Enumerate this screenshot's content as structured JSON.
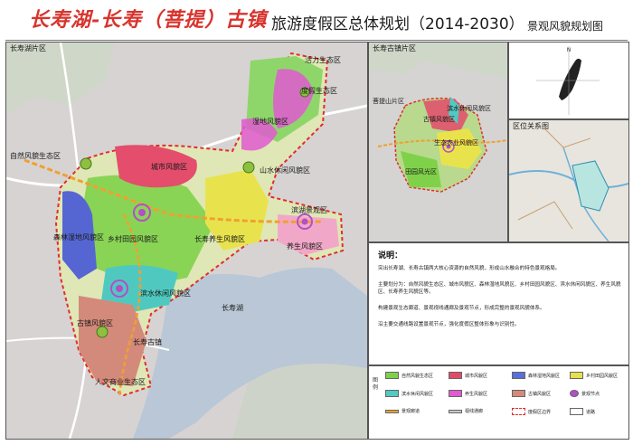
{
  "header": {
    "callig_title": "长寿湖-长寿（菩提）古镇",
    "main_title": "旅游度假区总体规划（2014-2030）",
    "sheet_title": "景观风貌规划图"
  },
  "main_map": {
    "area_label": "长寿湖片区",
    "zone_labels": {
      "z1": "自然风貌生态区",
      "z2": "城市风貌区",
      "z3": "森林湿地风貌区",
      "z4": "乡村田园风貌区",
      "z5": "滨水休闲风貌区",
      "z6": "养生风貌区",
      "z7": "长寿养生风貌区",
      "z8": "活力生态区",
      "z9": "山水休闲风貌区",
      "z10": "古镇风貌区",
      "z11": "人文商业生态区",
      "z12": "湿地风貌区",
      "z13": "度假生态区",
      "z14": "滨湖景观区"
    },
    "place_labels": {
      "lake": "长寿湖",
      "town": "长寿古镇"
    }
  },
  "inset_map": {
    "area_label": "长寿古镇片区",
    "zone_labels": {
      "a": "古镇风貌区",
      "b": "生态农业风貌区",
      "c": "滨水休闲风貌区",
      "d": "田园风光区"
    },
    "side_label": "菩提山片区"
  },
  "region_map": {
    "title": "区位关系图"
  },
  "notes": {
    "title": "说明：",
    "lines": [
      "突出长寿湖、长寿古镇两大核心资源的自然风貌，形成山水融合的特色景观格局。",
      "主要划分为：自然风貌生态区、城市风貌区、森林湿地风貌区、乡村田园风貌区、滨水休闲风貌区、养生风貌区、长寿养生风貌区等。",
      "构建景观生态廊道、景观视线通廊及景观节点，形成完整的景观风貌体系。",
      "沿主要交通线路设置景观节点，强化度假区整体形象与识别性。"
    ]
  },
  "legend": {
    "head": "图例",
    "items": [
      {
        "label": "自然风貌生态区",
        "color": "#7fd14a"
      },
      {
        "label": "城市风貌区",
        "color": "#e24a6a"
      },
      {
        "label": "森林湿地风貌区",
        "color": "#5b6fd8"
      },
      {
        "label": "乡村田园风貌区",
        "color": "#e6e14a"
      },
      {
        "label": "滨水休闲风貌区",
        "color": "#52c9c2"
      },
      {
        "label": "养生风貌区",
        "color": "#e05bd0"
      },
      {
        "label": "古镇风貌区",
        "color": "#d48a7a"
      },
      {
        "label": "景观节点",
        "color": "#b34fc8"
      },
      {
        "label": "景观廊道",
        "color": "#f0a030"
      },
      {
        "label": "视线通廊",
        "color": "#c8c8c8"
      },
      {
        "label": "度假区边界",
        "color": "#e02a2a"
      },
      {
        "label": "道路",
        "color": "#ffffff"
      }
    ]
  }
}
